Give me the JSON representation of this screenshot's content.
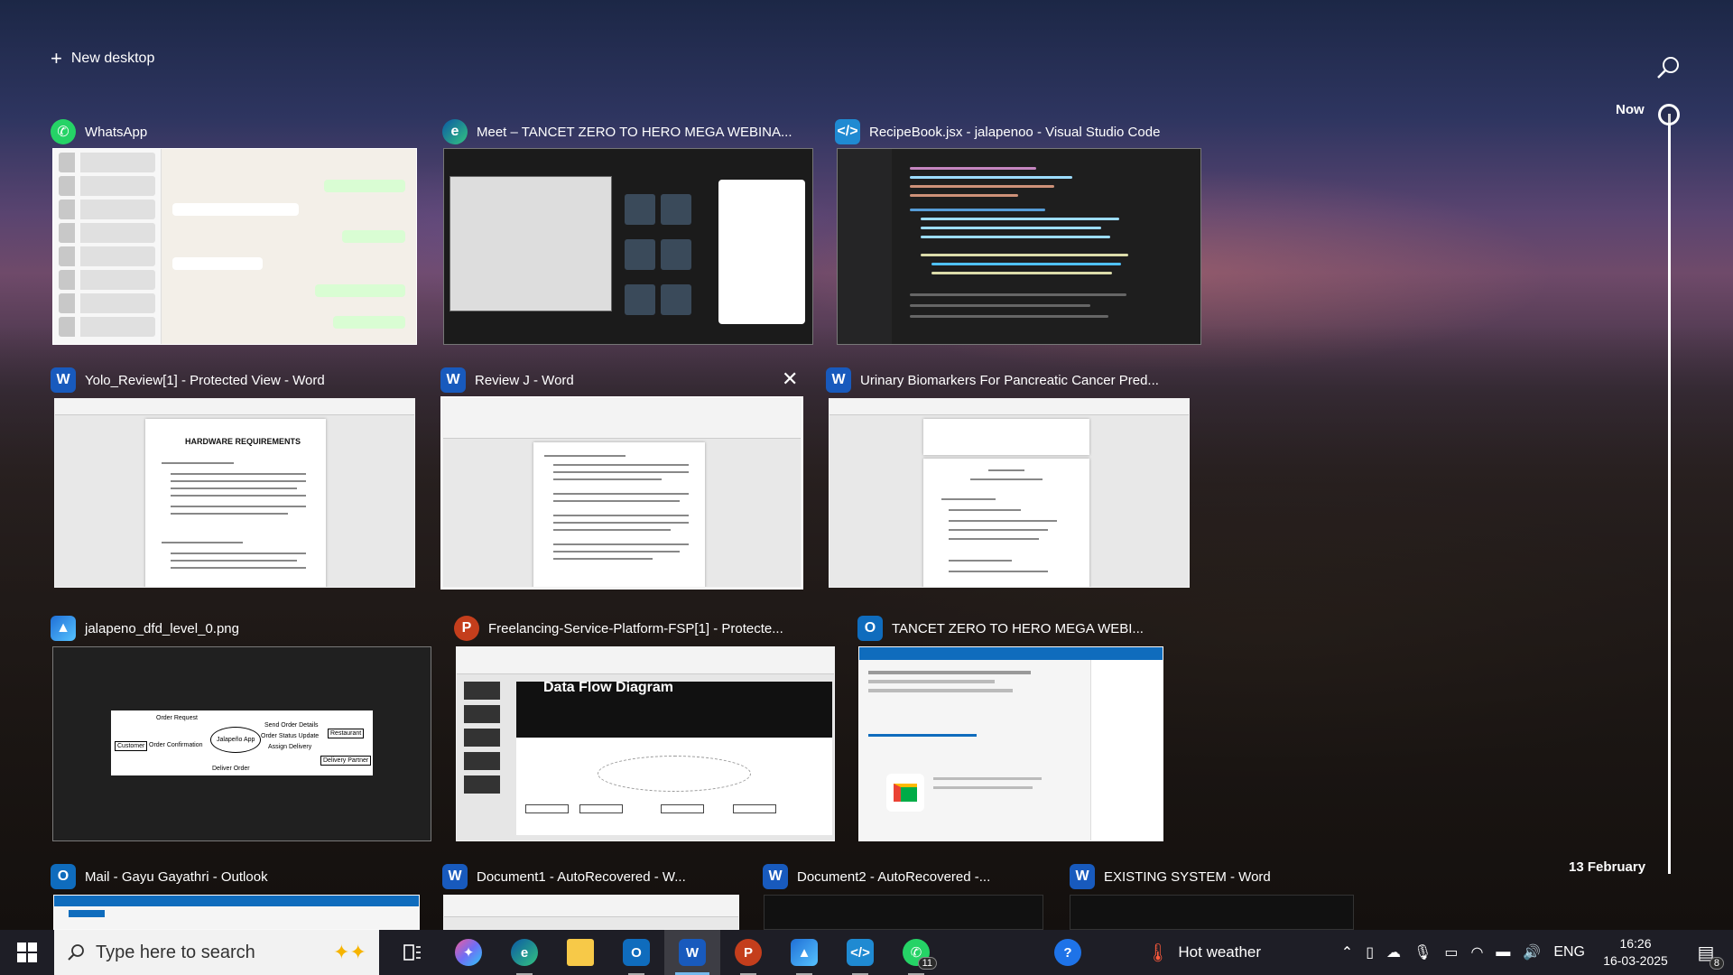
{
  "top": {
    "new_desktop_label": "New desktop",
    "search_icon": "search-icon"
  },
  "timeline": {
    "now_label": "Now",
    "date_label": "13 February"
  },
  "windows": [
    {
      "title": "WhatsApp",
      "app": "whatsapp"
    },
    {
      "title": "Meet – TANCET ZERO TO HERO MEGA WEBINA...",
      "app": "edge"
    },
    {
      "title": "RecipeBook.jsx - jalapenoo - Visual Studio Code",
      "app": "vscode"
    },
    {
      "title": "Yolo_Review[1]  -  Protected View - Word",
      "app": "word"
    },
    {
      "title": "Review J - Word",
      "app": "word"
    },
    {
      "title": "Urinary Biomarkers For Pancreatic Cancer Pred...",
      "app": "word"
    },
    {
      "title": "jalapeno_dfd_level_0.png",
      "app": "photos"
    },
    {
      "title": "Freelancing-Service-Platform-FSP[1]  -  Protecte...",
      "app": "powerpoint"
    },
    {
      "title": "TANCET ZERO TO HERO MEGA WEBI...",
      "app": "outlook"
    },
    {
      "title": "Mail - Gayu Gayathri - Outlook",
      "app": "outlook"
    },
    {
      "title": "Document1  -  AutoRecovered - W...",
      "app": "word"
    },
    {
      "title": "Document2  -  AutoRecovered -...",
      "app": "word"
    },
    {
      "title": "EXISTING SYSTEM - Word",
      "app": "word"
    }
  ],
  "thumb_text": {
    "hardware_heading": "HARDWARE REQUIREMENTS",
    "dfd_customer": "Customer",
    "dfd_app": "Jalapeño App",
    "dfd_restaurant": "Restaurant",
    "dfd_delivery": "Delivery Partner",
    "dfd_order_request": "Order Request",
    "dfd_order_confirmation": "Order Confirmation",
    "dfd_send_order": "Send Order Details",
    "dfd_status_update": "Order Status Update",
    "dfd_assign": "Assign Delivery",
    "dfd_deliver": "Deliver Order",
    "ppt_heading": "Data Flow Diagram"
  },
  "taskbar": {
    "search_placeholder": "Type here to search",
    "weather_text": "Hot weather",
    "language": "ENG",
    "time": "16:26",
    "date": "16-03-2025",
    "whatsapp_badge": "11",
    "notification_badge": "8",
    "apps": [
      "copilot-icon",
      "edge-icon",
      "file-explorer-icon",
      "outlook-icon",
      "word-icon",
      "powerpoint-icon",
      "photos-icon",
      "vscode-icon",
      "whatsapp-icon",
      "help-icon"
    ]
  },
  "colors": {
    "word": "#185abd",
    "powerpoint": "#c43e1c",
    "whatsapp": "#25d366",
    "vscode": "#1f8ad2",
    "outlook": "#0f6cbd",
    "accent": "#76b9ed"
  }
}
